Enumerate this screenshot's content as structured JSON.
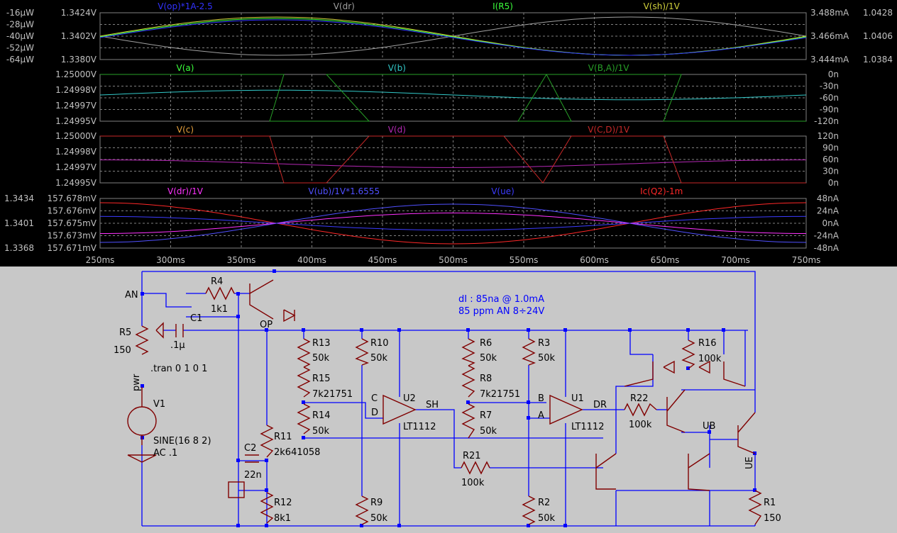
{
  "colors": {
    "plot_bg": "#000000",
    "grid": "#808080",
    "axis_text": "#c0c0c0",
    "schematic_bg": "#c8c8c8",
    "wire": "#0000ff",
    "component": "#800000",
    "label": "#000000",
    "note": "#0000ff"
  },
  "panes": [
    {
      "id": "p1",
      "traces": [
        {
          "label": "V(op)*1A-2.5",
          "color": "#3232ff"
        },
        {
          "label": "V(dr)",
          "color": "#a0a0a0"
        },
        {
          "label": "I(R5)",
          "color": "#3cff3c"
        },
        {
          "label": "V(sh)/1V",
          "color": "#d2d23c"
        }
      ],
      "left_axis_outer": [
        "-16µW",
        "-28µW",
        "-40µW",
        "-52µW",
        "-64µW"
      ],
      "left_axis_inner": [
        "1.3424V",
        "1.3402V",
        "1.3380V"
      ],
      "right_axis_inner": [
        "3.488mA",
        "3.466mA",
        "3.444mA"
      ],
      "right_axis_outer": [
        "1.0428",
        "1.0406",
        "1.0384"
      ]
    },
    {
      "id": "p2",
      "traces": [
        {
          "label": "V(a)",
          "color": "#3cff3c"
        },
        {
          "label": "V(b)",
          "color": "#32c8c8"
        },
        {
          "label": "V(B,A)/1V",
          "color": "#28a028"
        }
      ],
      "left_axis": [
        "1.25000V",
        "1.24998V",
        "1.24997V",
        "1.24995V"
      ],
      "right_axis": [
        "0n",
        "-30n",
        "-60n",
        "-90n",
        "-120n"
      ]
    },
    {
      "id": "p3",
      "traces": [
        {
          "label": "V(c)",
          "color": "#e6a03c"
        },
        {
          "label": "V(d)",
          "color": "#b428b4"
        },
        {
          "label": "V(C,D)/1V",
          "color": "#c82828"
        }
      ],
      "left_axis": [
        "1.25000V",
        "1.24998V",
        "1.24997V",
        "1.24995V"
      ],
      "right_axis": [
        "120n",
        "90n",
        "60n",
        "30n",
        "0n"
      ]
    },
    {
      "id": "p4",
      "traces": [
        {
          "label": "V(dr)/1V",
          "color": "#ff32ff"
        },
        {
          "label": "V(ub)/1V*1.6555",
          "color": "#5050ff"
        },
        {
          "label": "V(ue)",
          "color": "#3c3cff"
        },
        {
          "label": "Ic(Q2)-1m",
          "color": "#ff2828"
        }
      ],
      "left_axis_outer": [
        "1.3434",
        "1.3401",
        "1.3368"
      ],
      "left_axis_inner": [
        "157.678mV",
        "157.676mV",
        "157.675mV",
        "157.673mV",
        "157.671mV"
      ],
      "right_axis": [
        "48nA",
        "24nA",
        "0nA",
        "-24nA",
        "-48nA"
      ]
    }
  ],
  "x_axis": [
    "250ms",
    "300ms",
    "350ms",
    "400ms",
    "450ms",
    "500ms",
    "550ms",
    "600ms",
    "650ms",
    "700ms",
    "750ms"
  ],
  "schematic": {
    "note_line1": "dI : 85na @ 1.0mA",
    "note_line2": "85 ppm AN 8÷24V",
    "directive": ".tran 0 1 0 1",
    "source_name": "V1",
    "source_value": "SINE(16 8 2)",
    "source_ac": "AC .1",
    "nets": {
      "an": "AN",
      "op": "OP",
      "pwr": "pwr",
      "sh": "SH",
      "dr": "DR",
      "ub": "UB",
      "ue": "UE",
      "a": "A",
      "b": "B",
      "c": "C",
      "d": "D"
    },
    "components": [
      {
        "ref": "R4",
        "value": "1k1"
      },
      {
        "ref": "C1",
        "value": ".1µ"
      },
      {
        "ref": "R5",
        "value": "150"
      },
      {
        "ref": "R13",
        "value": "50k"
      },
      {
        "ref": "R15",
        "value": "7k21751"
      },
      {
        "ref": "R14",
        "value": "50k"
      },
      {
        "ref": "R11",
        "value": "2k641058"
      },
      {
        "ref": "C2",
        "value": "22n"
      },
      {
        "ref": "R12",
        "value": "8k1"
      },
      {
        "ref": "R10",
        "value": "50k"
      },
      {
        "ref": "R9",
        "value": "50k"
      },
      {
        "ref": "U2",
        "value": "LT1112"
      },
      {
        "ref": "R6",
        "value": "50k"
      },
      {
        "ref": "R8",
        "value": "7k21751"
      },
      {
        "ref": "R7",
        "value": "50k"
      },
      {
        "ref": "R21",
        "value": "100k"
      },
      {
        "ref": "R3",
        "value": "50k"
      },
      {
        "ref": "R2",
        "value": "50k"
      },
      {
        "ref": "U1",
        "value": "LT1112"
      },
      {
        "ref": "R22",
        "value": "100k"
      },
      {
        "ref": "R16",
        "value": "100k"
      },
      {
        "ref": "R1",
        "value": "150"
      }
    ]
  }
}
